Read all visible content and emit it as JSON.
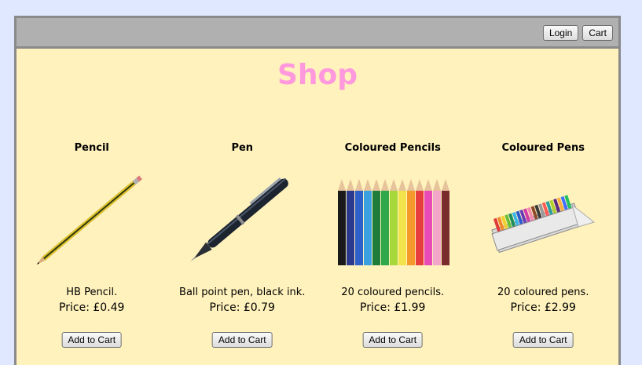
{
  "topbar": {
    "login_label": "Login",
    "cart_label": "Cart"
  },
  "page": {
    "title": "Shop"
  },
  "products": [
    {
      "name": "Pencil",
      "image_icon": "pencil-image",
      "description": "HB Pencil.",
      "price": "Price: £0.49",
      "button_label": "Add to Cart"
    },
    {
      "name": "Pen",
      "image_icon": "pen-image",
      "description": "Ball point pen, black ink.",
      "price": "Price: £0.79",
      "button_label": "Add to Cart"
    },
    {
      "name": "Coloured Pencils",
      "image_icon": "coloured-pencils-image",
      "description": "20 coloured pencils.",
      "price": "Price: £1.99",
      "button_label": "Add to Cart"
    },
    {
      "name": "Coloured Pens",
      "image_icon": "coloured-pens-image",
      "description": "20 coloured pens.",
      "price": "Price: £2.99",
      "button_label": "Add to Cart"
    }
  ],
  "colors": {
    "background": "#dfe8ff",
    "content": "#fff2bd",
    "topbar": "#b0b0b0",
    "title": "#ff99dd"
  }
}
